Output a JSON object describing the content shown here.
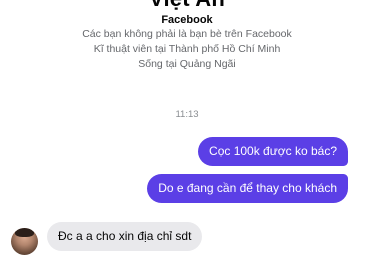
{
  "profile": {
    "name": "Việt An",
    "source": "Facebook",
    "lines": [
      "Các bạn không phải là bạn bè trên Facebook",
      "Kĩ thuật viên tại Thành phố Hồ Chí Minh",
      "Sống tại Quảng Ngãi"
    ]
  },
  "conversation": {
    "timestamp": "11:13",
    "outgoing": [
      "Cọc 100k được ko bác?",
      "Do e đang cần để thay cho khách"
    ],
    "incoming": [
      "Đc a a cho xin địa chỉ sdt"
    ]
  },
  "colors": {
    "outgoing_bubble": "#5b3fe6",
    "incoming_bubble": "#e9e9ec"
  }
}
